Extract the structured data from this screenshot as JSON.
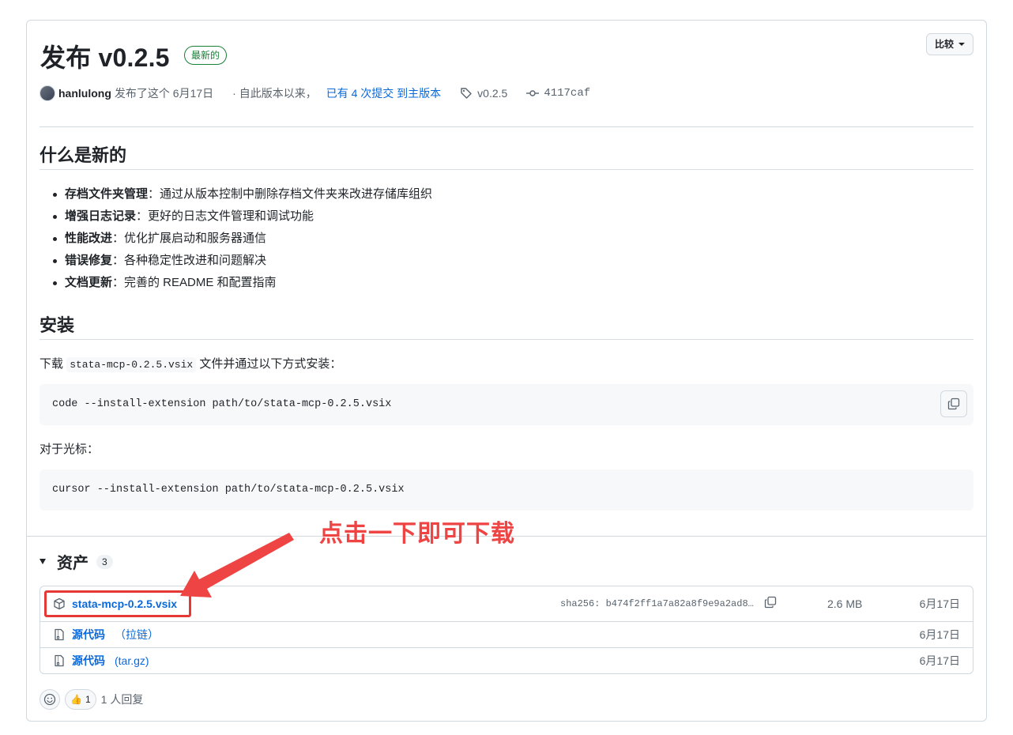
{
  "release": {
    "title": "发布 v0.2.5",
    "latest_badge": "最新的",
    "compare_label": "比较"
  },
  "meta": {
    "author": "hanlulong",
    "published_text": "发布了这个 6月17日",
    "since_text": "· 自此版本以来，",
    "commits_link": "已有 4 次提交 到主版本",
    "tag": "v0.2.5",
    "commit": "4117caf"
  },
  "whats_new": {
    "heading": "什么是新的",
    "items": [
      {
        "title": "存档文件夹管理",
        "desc": "：通过从版本控制中删除存档文件夹来改进存储库组织"
      },
      {
        "title": "增强日志记录",
        "desc": "：更好的日志文件管理和调试功能"
      },
      {
        "title": "性能改进",
        "desc": "：优化扩展启动和服务器通信"
      },
      {
        "title": "错误修复",
        "desc": "：各种稳定性改进和问题解决"
      },
      {
        "title": "文档更新",
        "desc": "：完善的 README 和配置指南"
      }
    ]
  },
  "install": {
    "heading": "安装",
    "intro_prefix": "下载",
    "intro_file": "stata-mcp-0.2.5.vsix",
    "intro_suffix": "文件并通过以下方式安装：",
    "code1": "code --install-extension path/to/stata-mcp-0.2.5.vsix",
    "cursor_label": "对于光标：",
    "code2": "cursor --install-extension path/to/stata-mcp-0.2.5.vsix"
  },
  "assets": {
    "heading": "资产",
    "count": "3",
    "rows": [
      {
        "name": "stata-mcp-0.2.5.vsix",
        "hash": "sha256: b474f2ff1a7a82a8f9e9a2ad8…",
        "size": "2.6 MB",
        "date": "6月17日"
      },
      {
        "name": "源代码",
        "sub": "（拉链）",
        "date": "6月17日"
      },
      {
        "name": "源代码",
        "sub": "(tar.gz)",
        "date": "6月17日"
      }
    ]
  },
  "annotation": {
    "text": "点击一下即可下载",
    "color": "#ef4444"
  },
  "reactions": {
    "thumbs_count": "1",
    "summary": "1 人回复"
  },
  "icons": {
    "tag": "tag-icon",
    "commit": "commit-icon",
    "copy": "copy-icon",
    "package": "package-icon",
    "zip": "file-zip-icon",
    "smiley": "smiley-icon",
    "thumbs": "thumbs-up-icon"
  }
}
